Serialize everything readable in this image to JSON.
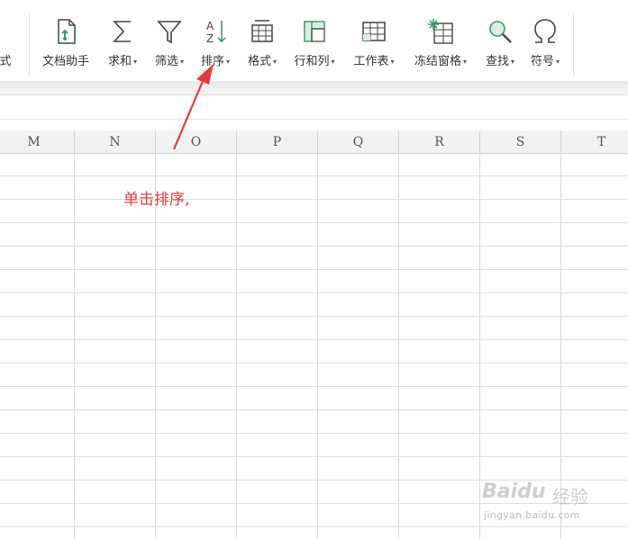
{
  "toolbar": {
    "cut_label": "式",
    "doc_helper": "文档助手",
    "sum": "求和",
    "filter": "筛选",
    "sort": "排序",
    "format": "格式",
    "rows_cols": "行和列",
    "worksheet": "工作表",
    "freeze": "冻结窗格",
    "find": "查找",
    "symbol": "符号",
    "caret": "▾",
    "icons": [
      "doc-helper-icon",
      "sum-icon",
      "filter-icon",
      "sort-icon",
      "format-icon",
      "rows-cols-icon",
      "worksheet-icon",
      "freeze-panes-icon",
      "find-icon",
      "symbol-icon"
    ]
  },
  "columns": [
    "M",
    "N",
    "O",
    "P",
    "Q",
    "R",
    "S",
    "T"
  ],
  "annotation": {
    "text": "单击排序,",
    "color": "#e53a3a"
  },
  "watermark": {
    "brand": "Baidu",
    "cn": "经验",
    "site": "jingyan.baidu.com"
  },
  "colors": {
    "accent_green": "#3a9a6a",
    "annotation_red": "#e53a3a",
    "grid_line": "#d9d9d9"
  }
}
